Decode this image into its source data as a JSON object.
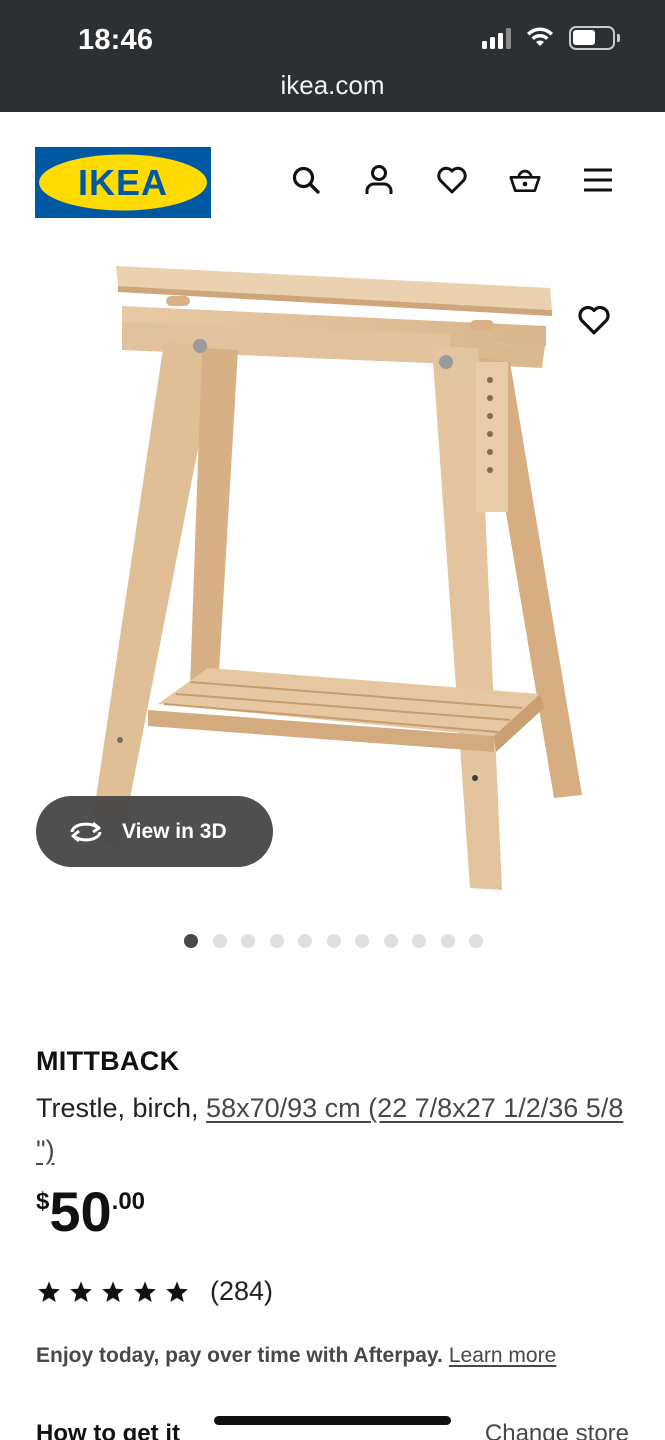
{
  "status_bar": {
    "time": "18:46"
  },
  "browser": {
    "url": "ikea.com"
  },
  "brand": {
    "logo_text": "IKEA",
    "blue": "#0058a3",
    "yellow": "#ffdb00"
  },
  "nav": {
    "icons": [
      "search-icon",
      "account-icon",
      "favorites-icon",
      "basket-icon",
      "menu-icon"
    ]
  },
  "gallery": {
    "view3d_label": "View in 3D",
    "dot_count": 11,
    "active_index": 0
  },
  "product": {
    "name": "MITTBACK",
    "desc_prefix": "Trestle, birch, ",
    "size_link": "58x70/93 cm (22 7/8x27 1/2/36 5/8 \")",
    "price_currency": "$",
    "price_whole": "50",
    "price_cents": ".00",
    "rating_stars": 5,
    "rating_count": "(284)"
  },
  "afterpay": {
    "text": "Enjoy today, pay over time with Afterpay.",
    "link": "Learn more"
  },
  "delivery": {
    "title": "How to get it",
    "change_store": "Change store"
  }
}
